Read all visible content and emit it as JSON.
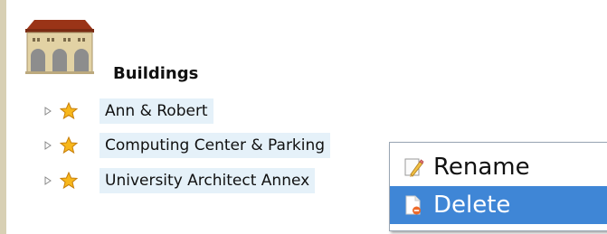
{
  "tree": {
    "root_label": "Buildings",
    "nodes": [
      {
        "label": "Ann & Robert"
      },
      {
        "label": "Computing Center & Parking"
      },
      {
        "label": "University Architect Annex"
      }
    ]
  },
  "context_menu": {
    "items": [
      {
        "label": "Rename",
        "icon": "pencil-icon"
      },
      {
        "label": "Delete",
        "icon": "delete-document-icon",
        "highlighted": true
      }
    ]
  },
  "colors": {
    "selection_bg": "#e5f1f9",
    "menu_highlight": "#3f86d6",
    "left_bar": "#d8d0b4"
  }
}
